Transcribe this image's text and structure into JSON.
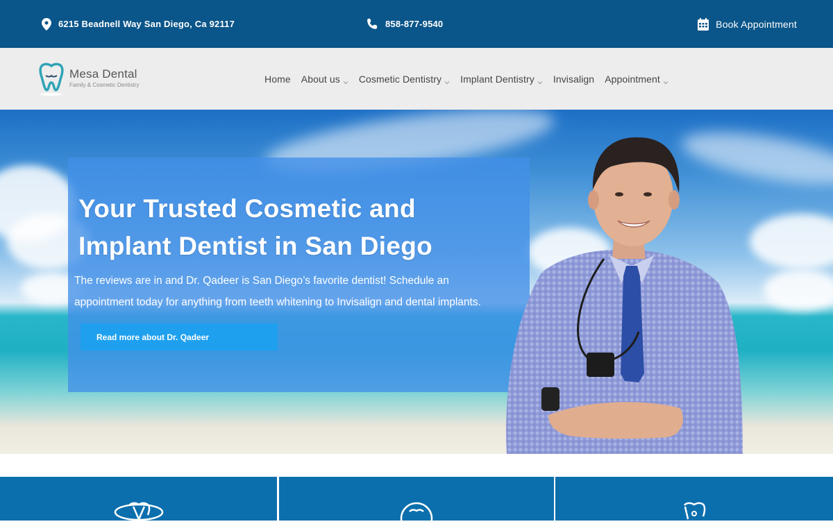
{
  "topbar": {
    "address": "6215 Beadnell Way San Diego, Ca 92117",
    "phone": "858-877-9540",
    "book_label": "Book Appointment"
  },
  "logo": {
    "name": "Mesa Dental",
    "tagline": "Family & Cosmetic Dentistry"
  },
  "nav": {
    "items": [
      {
        "label": "Home",
        "dropdown": false
      },
      {
        "label": "About us",
        "dropdown": true
      },
      {
        "label": "Cosmetic Dentistry",
        "dropdown": true
      },
      {
        "label": "Implant Dentistry",
        "dropdown": true
      },
      {
        "label": "Invisalign",
        "dropdown": false
      },
      {
        "label": "Appointment",
        "dropdown": true
      }
    ]
  },
  "hero": {
    "title_line1": "Your Trusted Cosmetic and",
    "title_line2": "Implant Dentist in San Diego",
    "text_line1": "The reviews are in and Dr. Qadeer is San Diego’s favorite dentist! Schedule an",
    "text_line2": "appointment today for anything from teeth whitening to Invisalign and dental implants.",
    "button_label": "Read more about Dr. Qadeer"
  },
  "services": {
    "icons": [
      "implant-teeth-icon",
      "tooth-circle-icon",
      "tooth-icon"
    ]
  },
  "colors": {
    "topbar_bg": "#0a5589",
    "nav_bg": "#ededed",
    "hero_box": "#428fe8",
    "button": "#1fa0ef",
    "services_bg": "#0c6fad"
  }
}
